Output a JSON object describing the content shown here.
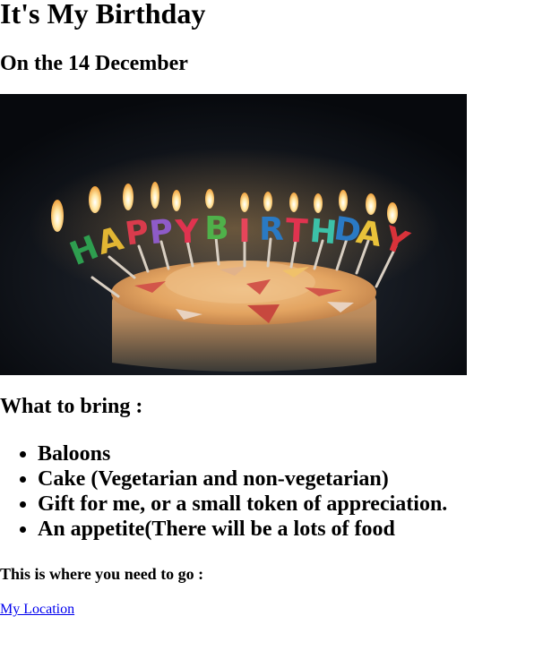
{
  "page": {
    "title": "It's My Birthday",
    "subtitle": "On the 14 December"
  },
  "image": {
    "subject": "birthday-cake-with-candles",
    "candle_letters": [
      {
        "letter": "H",
        "color": "#2e9e4f"
      },
      {
        "letter": "A",
        "color": "#e2b633"
      },
      {
        "letter": "P",
        "color": "#d93b4c"
      },
      {
        "letter": "P",
        "color": "#8e5bc8"
      },
      {
        "letter": "Y",
        "color": "#e0334f"
      },
      {
        "letter": "B",
        "color": "#4fb14a"
      },
      {
        "letter": "I",
        "color": "#e6455a"
      },
      {
        "letter": "R",
        "color": "#2a7ac4"
      },
      {
        "letter": "T",
        "color": "#e0334f"
      },
      {
        "letter": "H",
        "color": "#3cc1a8"
      },
      {
        "letter": "D",
        "color": "#2a7ac4"
      },
      {
        "letter": "A",
        "color": "#e9c23a"
      },
      {
        "letter": "Y",
        "color": "#d9323a"
      }
    ]
  },
  "bring": {
    "heading": "What to bring :",
    "items": [
      "Baloons",
      "Cake (Vegetarian and non-vegetarian)",
      "Gift for me, or a small token of appreciation.",
      "An appetite(There will be a lots of food"
    ]
  },
  "directions": {
    "text": "This is where you need to go :",
    "link_label": "My Location"
  }
}
